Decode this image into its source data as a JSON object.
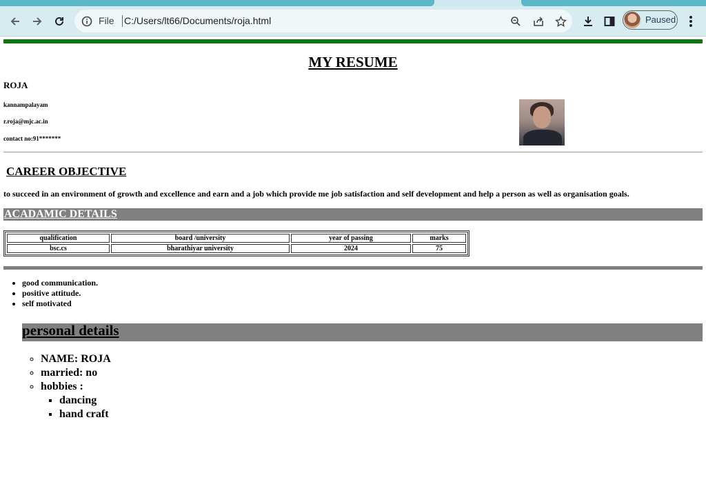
{
  "browser": {
    "file_label": "File",
    "url": "C:/Users/lt66/Documents/roja.html",
    "profile_status": "Paused",
    "icons": [
      "back-icon",
      "forward-icon",
      "reload-icon",
      "info-icon",
      "zoom-icon",
      "share-icon",
      "star-icon",
      "download-icon",
      "sidebar-icon",
      "menu-icon"
    ]
  },
  "resume": {
    "title": "MY RESUME",
    "name": "ROJA",
    "location": "kannampalayam",
    "email": "r.roja@mjc.ac.in",
    "contact": "contact no:91*******",
    "career_heading": "CAREER OBJECTIVE",
    "objective": "to succeed in an environment of growth and excellence and earn and a job which provide me job satisfaction and self development and help a person as well as organisation goals.",
    "academic_heading": "ACADAMIC DETAILS",
    "table": {
      "headers": [
        "qualification",
        "board /university",
        "year of passing",
        "marks"
      ],
      "rows": [
        [
          "bsc.cs",
          "bharathiyar university",
          "2024",
          "75"
        ]
      ]
    },
    "skills": [
      "good communication.",
      "positive attitude.",
      "self motivated"
    ],
    "personal_heading": "personal details",
    "personal": {
      "name": "NAME: ROJA",
      "married": "married: no",
      "hobbies_label": "hobbies :",
      "hobbies": [
        "dancing",
        "hand craft"
      ]
    }
  },
  "colors": {
    "green_bar": "#0a780a",
    "gray_band": "#808080"
  }
}
